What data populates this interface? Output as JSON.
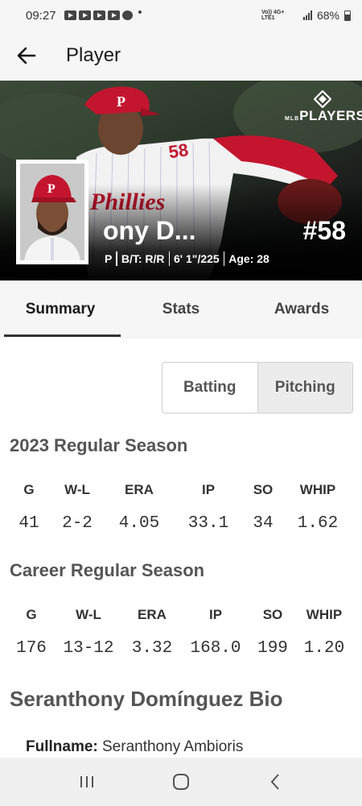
{
  "status_bar": {
    "time": "09:27",
    "network": "Vo)) 4G+ LTE1",
    "battery": "68%"
  },
  "app_bar": {
    "title": "Player"
  },
  "hero": {
    "brand_mlb": "MLB",
    "brand_players": "PLAYERS",
    "name_visible": "ony D...",
    "number": "#58",
    "position": "P",
    "bats_throws": "B/T: R/R",
    "height_weight": "6' 1\"/225",
    "age": "Age: 28",
    "team_color": "#c4152f"
  },
  "tabs": [
    {
      "label": "Summary",
      "active": true
    },
    {
      "label": "Stats",
      "active": false
    },
    {
      "label": "Awards",
      "active": false
    }
  ],
  "toggle": {
    "batting": "Batting",
    "pitching": "Pitching",
    "selected": "Pitching"
  },
  "season": {
    "title": "2023 Regular Season",
    "headers": [
      "G",
      "W-L",
      "ERA",
      "IP",
      "SO",
      "WHIP"
    ],
    "values": [
      "41",
      "2-2",
      "4.05",
      "33.1",
      "34",
      "1.62"
    ]
  },
  "career": {
    "title": "Career Regular Season",
    "headers": [
      "G",
      "W-L",
      "ERA",
      "IP",
      "SO",
      "WHIP"
    ],
    "values": [
      "176",
      "13-12",
      "3.32",
      "168.0",
      "199",
      "1.20"
    ]
  },
  "bio": {
    "title": "Seranthony Domínguez Bio",
    "fullname_label": "Fullname:",
    "fullname_value": " Seranthony Ambioris"
  },
  "icons": {
    "back": "arrow-left-icon",
    "recents": "recent-apps-icon",
    "home": "home-icon",
    "nav_back": "chevron-left-icon"
  }
}
